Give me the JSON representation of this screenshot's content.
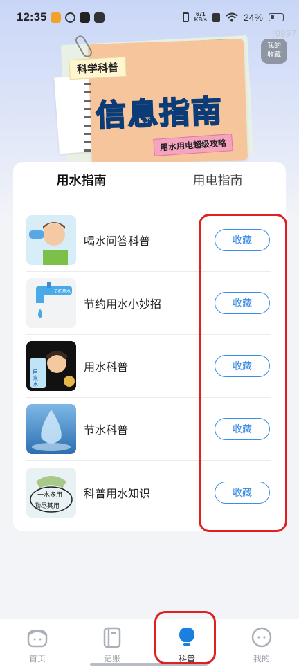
{
  "status_bar": {
    "time": "12:35",
    "speed_value": "671",
    "speed_unit": "KB/s",
    "battery": "24%",
    "faint_id": "(0897"
  },
  "banner": {
    "tag": "科学科普",
    "title": "信息指南",
    "ribbon": "用水用电超级攻略",
    "favorites_button": [
      "我的",
      "收藏"
    ]
  },
  "tabs": [
    {
      "label": "用水指南",
      "active": true
    },
    {
      "label": "用电指南",
      "active": false
    }
  ],
  "articles": [
    {
      "title": "喝水问答科普",
      "button": "收藏",
      "thumb": "boy-drinking-water-image"
    },
    {
      "title": "节约用水小妙招",
      "button": "收藏",
      "thumb": "dripping-faucet-image",
      "thumb_text": "节约用水"
    },
    {
      "title": "用水科普",
      "button": "收藏",
      "thumb": "cartoon-water-glass-image",
      "thumb_text": "自来水"
    },
    {
      "title": "节水科普",
      "button": "收藏",
      "thumb": "water-drop-image"
    },
    {
      "title": "科普用水知识",
      "button": "收藏",
      "thumb": "water-saving-slogan-image",
      "thumb_text": [
        "一水多用",
        "物尽其用"
      ]
    }
  ],
  "bottom_nav": [
    {
      "label": "首页",
      "icon": "home-icon",
      "active": false
    },
    {
      "label": "记账",
      "icon": "ledger-icon",
      "active": false
    },
    {
      "label": "科普",
      "icon": "lightbulb-icon",
      "active": true
    },
    {
      "label": "我的",
      "icon": "profile-face-icon",
      "active": false
    }
  ],
  "colors": {
    "accent": "#2f84e3",
    "highlight_box": "#e02020",
    "active_nav": "#1b7fe0"
  }
}
